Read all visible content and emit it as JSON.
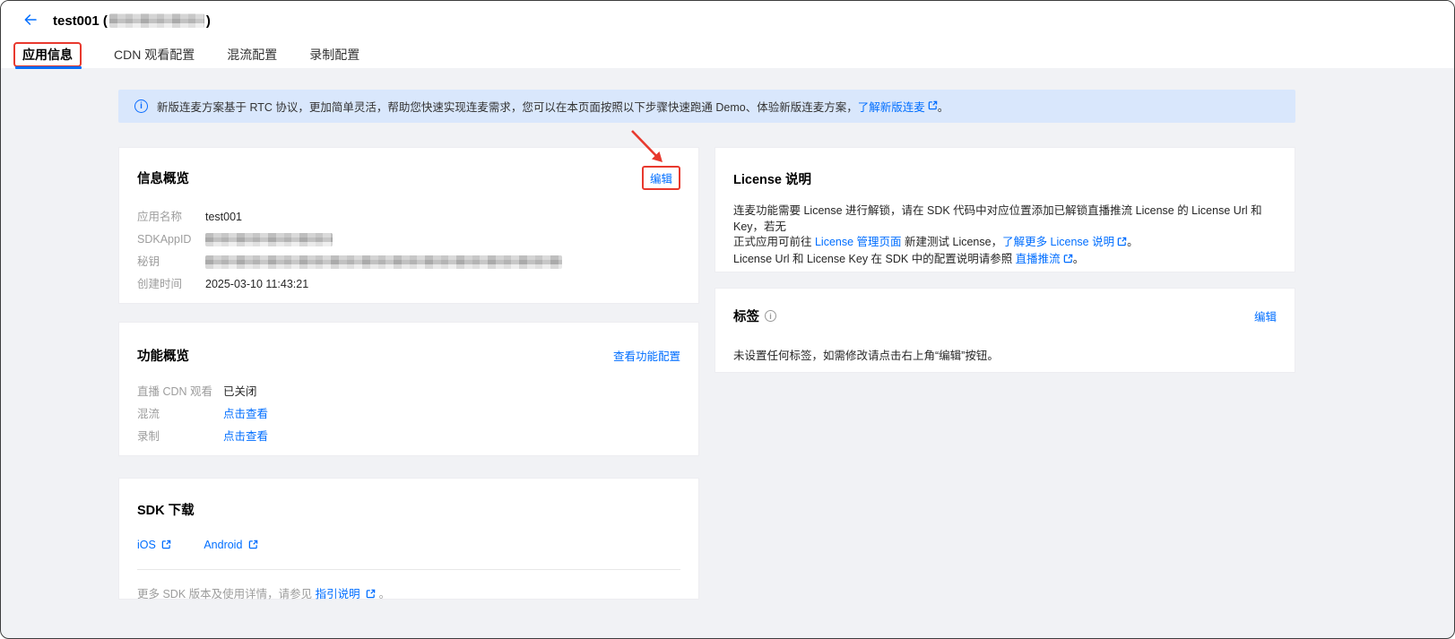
{
  "colors": {
    "accent_blue": "#006eff",
    "annotation_red": "#e8392e",
    "status_closed_red": "#e54545",
    "banner_bg": "#d9e7fc",
    "page_bg": "#f1f2f5"
  },
  "header": {
    "title_prefix": "test001 (",
    "title_suffix": ")"
  },
  "tabs": [
    {
      "label": "应用信息",
      "active": true
    },
    {
      "label": "CDN 观看配置",
      "active": false
    },
    {
      "label": "混流配置",
      "active": false
    },
    {
      "label": "录制配置",
      "active": false
    }
  ],
  "banner": {
    "text": "新版连麦方案基于 RTC 协议，更加简单灵活，帮助您快速实现连麦需求，您可以在本页面按照以下步骤快速跑通 Demo、体验新版连麦方案，",
    "link_label": "了解新版连麦",
    "suffix": "。"
  },
  "info_overview": {
    "title": "信息概览",
    "edit_label": "编辑",
    "rows": [
      {
        "label": "应用名称",
        "value": "test001",
        "masked": false
      },
      {
        "label": "SDKAppID",
        "value": "",
        "masked": true
      },
      {
        "label": "秘钥",
        "value": "",
        "masked": true
      },
      {
        "label": "创建时间",
        "value": "2025-03-10 11:43:21",
        "masked": false
      }
    ]
  },
  "feature_overview": {
    "title": "功能概览",
    "config_link_label": "查看功能配置",
    "rows": [
      {
        "label": "直播 CDN 观看",
        "value": "已关闭",
        "type": "status"
      },
      {
        "label": "混流",
        "value": "点击查看",
        "type": "link"
      },
      {
        "label": "录制",
        "value": "点击查看",
        "type": "link"
      }
    ]
  },
  "license_card": {
    "title": "License 说明",
    "line1": "连麦功能需要 License 进行解锁，请在 SDK 代码中对应位置添加已解锁直播推流 License 的 License Url 和 Key，若无",
    "line2_pre": "正式应用可前往 ",
    "line2_link1": "License 管理页面",
    "line2_mid": " 新建测试 License，",
    "line2_link2": "了解更多 License 说明",
    "line2_suffix": "。",
    "line3_pre": "License Url 和 License Key 在 SDK 中的配置说明请参照 ",
    "line3_link": "直播推流",
    "line3_suffix": "。"
  },
  "tags_card": {
    "title": "标签",
    "edit_label": "编辑",
    "text": "未设置任何标签，如需修改请点击右上角“编辑”按钮。"
  },
  "sdk_card": {
    "title": "SDK 下载",
    "links": [
      {
        "label": "iOS"
      },
      {
        "label": "Android"
      }
    ],
    "footer_text": "更多 SDK 版本及使用详情，请参见 ",
    "footer_link": "指引说明",
    "footer_suffix": "。"
  }
}
